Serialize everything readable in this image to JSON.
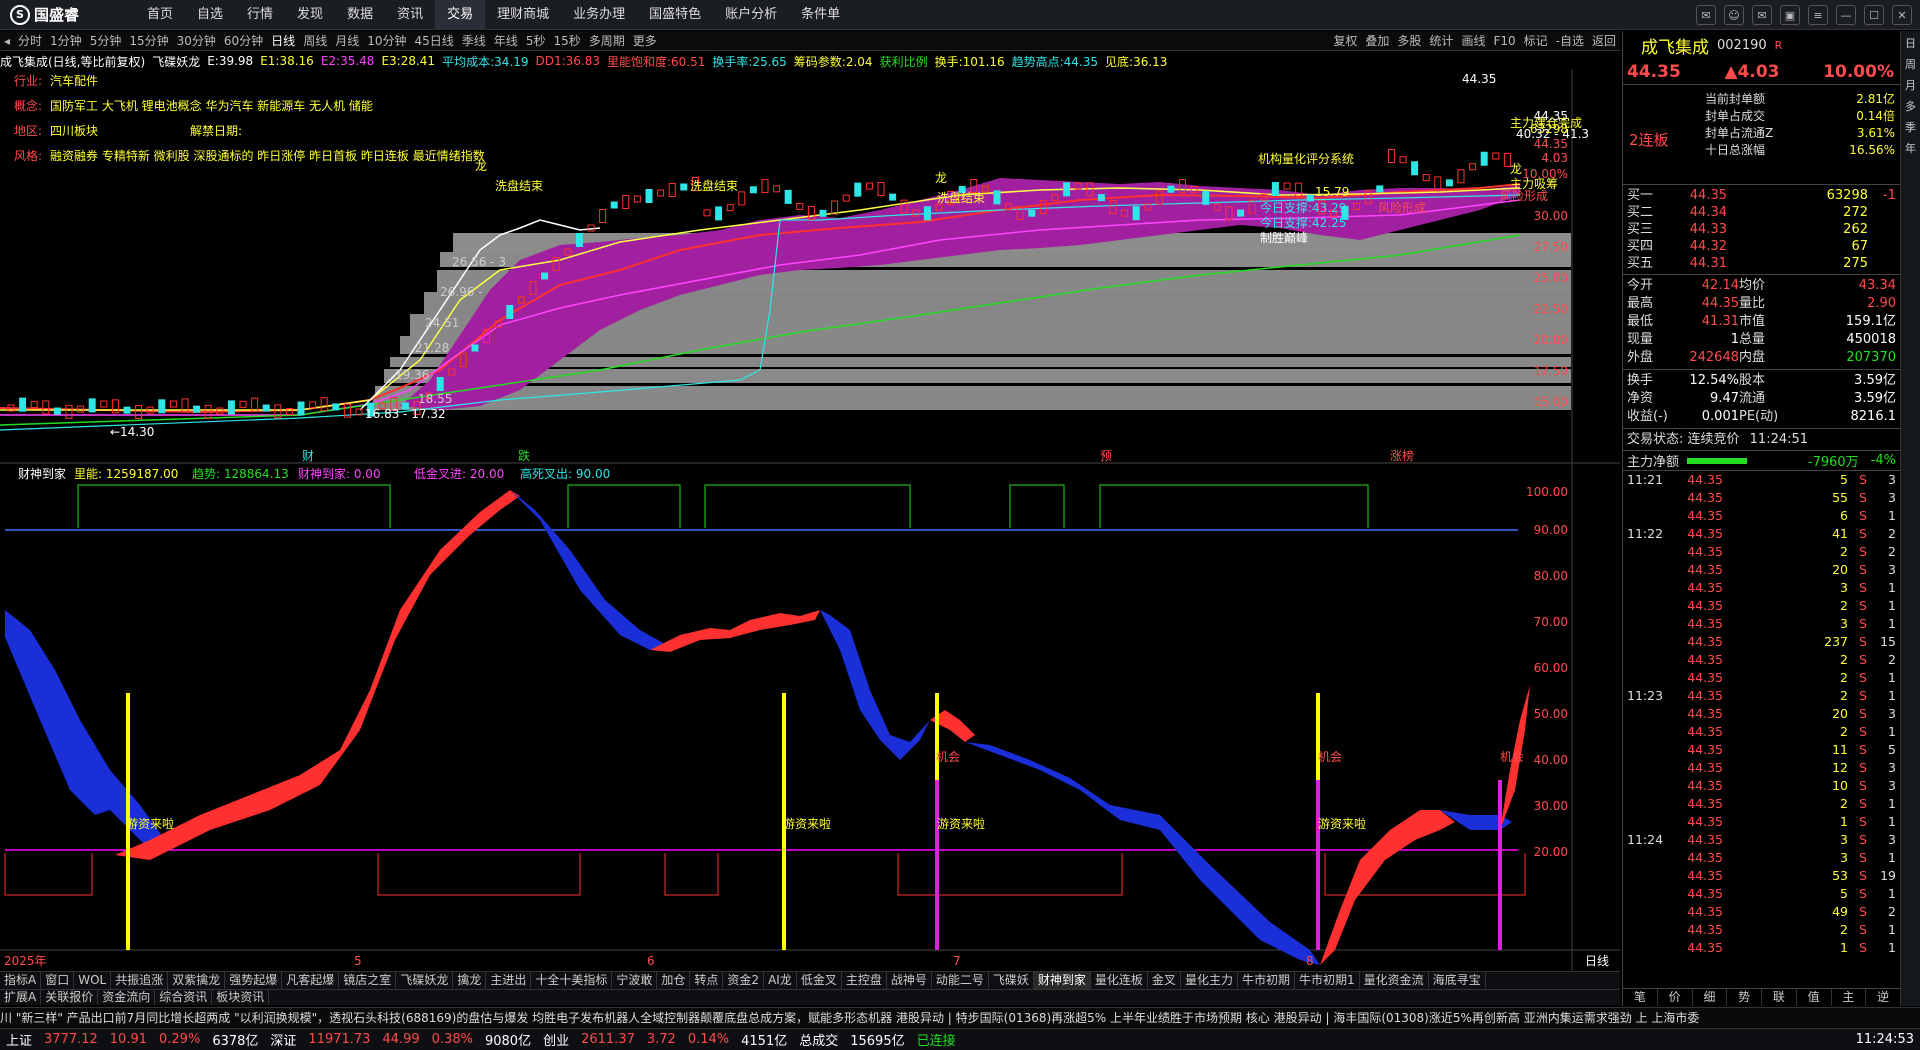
{
  "app": {
    "logo": "国盛睿"
  },
  "menu": [
    "首页",
    "自选",
    "行情",
    "发现",
    "数据",
    "资讯",
    "交易",
    "理财商城",
    "业务办理",
    "国盛特色",
    "账户分析",
    "条件单"
  ],
  "menu_active": "交易",
  "periods": [
    "分时",
    "1分钟",
    "5分钟",
    "15分钟",
    "30分钟",
    "60分钟",
    "日线",
    "周线",
    "月线",
    "10分钟",
    "45日线",
    "季线",
    "年线",
    "5秒",
    "15秒",
    "多周期",
    "更多"
  ],
  "period_active": "日线",
  "toolbar_right": [
    "复权",
    "叠加",
    "多股",
    "统计",
    "画线",
    "F10",
    "标记",
    "-自选",
    "返回"
  ],
  "infobar": [
    {
      "t": "成飞集成(日线,等比前复权)",
      "c": "w"
    },
    {
      "t": "飞碟妖龙",
      "c": "w"
    },
    {
      "t": "E:39.98",
      "c": "w"
    },
    {
      "t": "E1:38.16",
      "c": "y"
    },
    {
      "t": "E2:35.48",
      "c": "m"
    },
    {
      "t": "E3:28.41",
      "c": "y"
    },
    {
      "t": "平均成本:34.19",
      "c": "c"
    },
    {
      "t": "DD1:36.83",
      "c": "r"
    },
    {
      "t": "里能饱和度:60.51",
      "c": "r"
    },
    {
      "t": "换手率:25.65",
      "c": "c"
    },
    {
      "t": "筹码参数:2.04",
      "c": "y"
    },
    {
      "t": "获利比例",
      "c": "gn"
    },
    {
      "t": "换手:101.16",
      "c": "y"
    },
    {
      "t": "趋势高点:44.35",
      "c": "c"
    },
    {
      "t": "见底:36.13",
      "c": "y"
    }
  ],
  "chart_meta": {
    "industry_label": "行业:",
    "industry": "汽车配件",
    "concept_label": "概念:",
    "concept": "国防军工 大飞机 锂电池概念 华为汽车 新能源车 无人机 储能",
    "region_label": "地区:",
    "region": "四川板块",
    "unlock_label": "解禁日期:",
    "style_label": "风格:",
    "style": "融资融券 专精特新 微利股 深股通标的 昨日涨停 昨日首板 昨日连板 最近情绪指数"
  },
  "annotations": {
    "xipan1": "洗盘结束",
    "xipan2": "洗盘结束",
    "xipan3": "洗盘结束",
    "jigou": "机构量化评分系统",
    "jianghou": "主力吸筹",
    "jiancang": "主力建仓完成",
    "support1": "今日支撑:43.29",
    "support2": "今日支撑:42.25",
    "zhisheng": "制胜巅峰",
    "low": "←14.30",
    "range": "16.83 - 17.32",
    "peak": "44.35",
    "zhang": "涨榜",
    "cai": "财",
    "die": "跌",
    "yu": "预",
    "long": "龙",
    "price_a": "26.56 - 3",
    "price_b": "26.96 -",
    "price_c": "24.51",
    "price_d": "21.28",
    "price_e": "19.36",
    "price_f": "18.55",
    "price_g": "40.32 - 41.3",
    "price_h": "15.79",
    "fengxian": "风险形成"
  },
  "price_axis": [
    "44.35",
    "63298",
    "44.35",
    "4.03",
    "10.00%",
    "30.00",
    "27.50",
    "25.00",
    "22.50",
    "20.00",
    "17.50",
    "15.00"
  ],
  "lower_indicator": {
    "name": "财神到家",
    "vals": [
      {
        "t": "里能: 1259187.00",
        "c": "y"
      },
      {
        "t": "趋势: 128864.13",
        "c": "gn"
      },
      {
        "t": "财神到家: 0.00",
        "c": "m"
      },
      {
        "t": "低金叉进: 20.00",
        "c": "m"
      },
      {
        "t": "高死叉出: 90.00",
        "c": "c"
      }
    ],
    "axis": [
      "100.00",
      "90.00",
      "80.00",
      "70.00",
      "60.00",
      "50.00",
      "40.00",
      "30.00",
      "20.00"
    ],
    "label_zijin": "游资来啦",
    "label_jihui": "机会"
  },
  "x_labels": [
    "2025年",
    "5",
    "6",
    "7",
    "8",
    "日线"
  ],
  "bottom_tabs": [
    "指标A",
    "窗口",
    "WOL",
    "共振追涨",
    "双紫擒龙",
    "强势起爆",
    "凡客起爆",
    "镜店之室",
    "飞碟妖龙",
    "擒龙",
    "主进出",
    "十全十美指标",
    "宁波敢",
    "加仓",
    "转点",
    "资金2",
    "AI龙",
    "低金叉",
    "主控盘",
    "战神号",
    "动能二号",
    "飞碟妖",
    "财神到家",
    "量化连板",
    "金叉",
    "量化主力",
    "牛市初期",
    "牛市初期1",
    "量化资金流",
    "海底寻宝"
  ],
  "bottom_tab_active": "财神到家",
  "bottom_tabs2": [
    "扩展A",
    "关联报价",
    "资金流向",
    "综合资讯",
    "板块资讯"
  ],
  "bottom_right": [
    "指标B",
    "模",
    "板"
  ],
  "ticker": "川 \"新三样\" 产品出口前7月同比增长超两成        \"以利润换规模\"，透视石头科技(688169)的盘估与爆发        均胜电子发布机器人全域控制器颠覆底盘总成方案，赋能多形态机器        港股异动  |  特步国际(01368)再涨超5% 上半年业绩胜于市场预期 核心        港股异动  |  海丰国际(01308)涨近5%再创新高 亚洲内集运需求强劲 上        上海市委",
  "status": [
    {
      "name": "上证",
      "v": "3777.12",
      "d": "10.91",
      "p": "0.29%",
      "a": "6378亿"
    },
    {
      "name": "深证",
      "v": "11971.73",
      "d": "44.99",
      "p": "0.38%",
      "a": "9080亿"
    },
    {
      "name": "创业",
      "v": "2611.37",
      "d": "3.72",
      "p": "0.14%",
      "a": "4151亿"
    }
  ],
  "status_total_label": "总成交",
  "status_total": "15695亿",
  "status_conn": "已连接",
  "status_time": "11:24:53",
  "right": {
    "name": "成飞集成",
    "code": "002190",
    "flag": "R",
    "price": "44.35",
    "change": "▲4.03",
    "pct": "10.00%",
    "lianban": "2连板",
    "limit_rows": [
      {
        "k": "当前封单额",
        "v": "2.81亿"
      },
      {
        "k": "封单占成交",
        "v": "0.14倍"
      },
      {
        "k": "封单占流通Z",
        "v": "3.61%"
      },
      {
        "k": "十日总涨幅",
        "v": "16.56%"
      }
    ],
    "book": [
      {
        "l": "买一",
        "p": "44.35",
        "v": "63298",
        "d": "-1"
      },
      {
        "l": "买二",
        "p": "44.34",
        "v": "272",
        "d": ""
      },
      {
        "l": "买三",
        "p": "44.33",
        "v": "262",
        "d": ""
      },
      {
        "l": "买四",
        "p": "44.32",
        "v": "67",
        "d": ""
      },
      {
        "l": "买五",
        "p": "44.31",
        "v": "275",
        "d": ""
      }
    ],
    "quote": [
      [
        "今开",
        "42.14",
        "均价",
        "43.34"
      ],
      [
        "最高",
        "44.35",
        "量比",
        "2.90"
      ],
      [
        "最低",
        "41.31",
        "市值",
        "159.1亿"
      ],
      [
        "现量",
        "1",
        "总量",
        "450018"
      ],
      [
        "外盘",
        "242648",
        "内盘",
        "207370"
      ]
    ],
    "quote2": [
      [
        "换手",
        "12.54%",
        "股本",
        "3.59亿"
      ],
      [
        "净资",
        "9.47",
        "流通",
        "3.59亿"
      ],
      [
        "收益(-)",
        "0.001",
        "PE(动)",
        "8216.1"
      ]
    ],
    "trade_state": "交易状态: 连续竞价",
    "trade_time": "11:24:51",
    "net_label": "主力净额",
    "net_val": "-7960万",
    "net_pct": "-4%",
    "ticks": [
      {
        "t": "11:21",
        "p": "44.35",
        "v": "5",
        "s": "S",
        "n": "3"
      },
      {
        "t": "",
        "p": "44.35",
        "v": "55",
        "s": "S",
        "n": "3"
      },
      {
        "t": "",
        "p": "44.35",
        "v": "6",
        "s": "S",
        "n": "1"
      },
      {
        "t": "11:22",
        "p": "44.35",
        "v": "41",
        "s": "S",
        "n": "2"
      },
      {
        "t": "",
        "p": "44.35",
        "v": "2",
        "s": "S",
        "n": "2"
      },
      {
        "t": "",
        "p": "44.35",
        "v": "20",
        "s": "S",
        "n": "3"
      },
      {
        "t": "",
        "p": "44.35",
        "v": "3",
        "s": "S",
        "n": "1"
      },
      {
        "t": "",
        "p": "44.35",
        "v": "2",
        "s": "S",
        "n": "1"
      },
      {
        "t": "",
        "p": "44.35",
        "v": "3",
        "s": "S",
        "n": "1"
      },
      {
        "t": "",
        "p": "44.35",
        "v": "237",
        "s": "S",
        "n": "15"
      },
      {
        "t": "",
        "p": "44.35",
        "v": "2",
        "s": "S",
        "n": "2"
      },
      {
        "t": "",
        "p": "44.35",
        "v": "2",
        "s": "S",
        "n": "1"
      },
      {
        "t": "11:23",
        "p": "44.35",
        "v": "2",
        "s": "S",
        "n": "1"
      },
      {
        "t": "",
        "p": "44.35",
        "v": "20",
        "s": "S",
        "n": "3"
      },
      {
        "t": "",
        "p": "44.35",
        "v": "2",
        "s": "S",
        "n": "1"
      },
      {
        "t": "",
        "p": "44.35",
        "v": "11",
        "s": "S",
        "n": "5"
      },
      {
        "t": "",
        "p": "44.35",
        "v": "12",
        "s": "S",
        "n": "3"
      },
      {
        "t": "",
        "p": "44.35",
        "v": "10",
        "s": "S",
        "n": "3"
      },
      {
        "t": "",
        "p": "44.35",
        "v": "2",
        "s": "S",
        "n": "1"
      },
      {
        "t": "",
        "p": "44.35",
        "v": "1",
        "s": "S",
        "n": "1"
      },
      {
        "t": "11:24",
        "p": "44.35",
        "v": "3",
        "s": "S",
        "n": "3"
      },
      {
        "t": "",
        "p": "44.35",
        "v": "3",
        "s": "S",
        "n": "1"
      },
      {
        "t": "",
        "p": "44.35",
        "v": "53",
        "s": "S",
        "n": "19"
      },
      {
        "t": "",
        "p": "44.35",
        "v": "5",
        "s": "S",
        "n": "1"
      },
      {
        "t": "",
        "p": "44.35",
        "v": "49",
        "s": "S",
        "n": "2"
      },
      {
        "t": "",
        "p": "44.35",
        "v": "2",
        "s": "S",
        "n": "1"
      },
      {
        "t": "",
        "p": "44.35",
        "v": "1",
        "s": "S",
        "n": "1"
      }
    ],
    "bottom_tabs": [
      "笔",
      "价",
      "细",
      "势",
      "联",
      "值",
      "主",
      "逆"
    ]
  },
  "rail": [
    "日",
    "周",
    "月",
    "多",
    "季",
    "年"
  ]
}
